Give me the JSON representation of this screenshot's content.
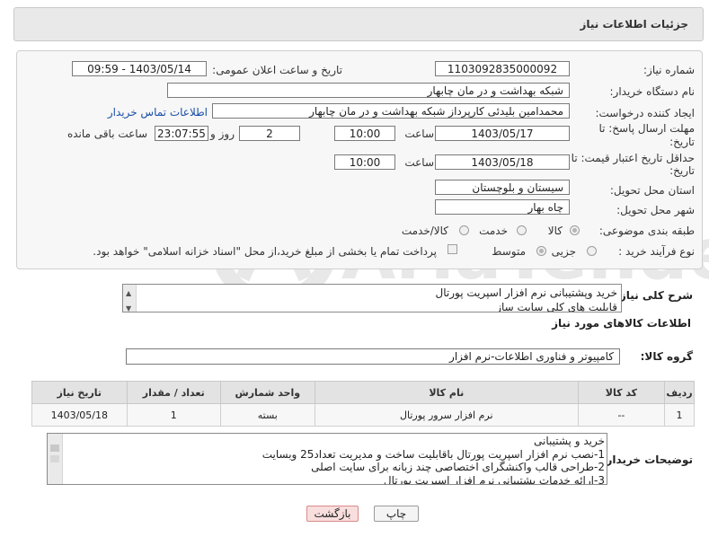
{
  "header": {
    "title": "جزئیات اطلاعات نیاز"
  },
  "form": {
    "need_number_label": "شماره نیاز:",
    "need_number": "1103092835000092",
    "announce_label": "تاریخ و ساعت اعلان عمومی:",
    "announce_value": "1403/05/14 - 09:59",
    "buyer_org_label": "نام دستگاه خریدار:",
    "buyer_org": "شبکه بهداشت و در مان چابهار",
    "requester_label": "ایجاد کننده درخواست:",
    "requester": "محمدامین بلیدئی کارپرداز شبکه بهداشت و در مان چابهار",
    "contact_link": "اطلاعات تماس خریدار",
    "deadline_label_1": "مهلت ارسال پاسخ: تا",
    "deadline_label_2": "تاریخ:",
    "deadline_date": "1403/05/17",
    "time_label": "ساعت",
    "deadline_time": "10:00",
    "days_value": "2",
    "days_label": "روز و",
    "remaining_time": "23:07:55",
    "remaining_label": "ساعت باقی مانده",
    "validity_label_1": "حداقل تاریخ اعتبار قیمت: تا",
    "validity_label_2": "تاریخ:",
    "validity_date": "1403/05/18",
    "validity_time": "10:00",
    "province_label": "استان محل تحویل:",
    "province": "سیستان و بلوچستان",
    "city_label": "شهر محل تحویل:",
    "city": "چاه بهار",
    "category_label": "طبقه بندی موضوعی:",
    "category_options": [
      "کالا",
      "خدمت",
      "کالا/خدمت"
    ],
    "purchase_type_label": "نوع فرآیند خرید :",
    "purchase_options": [
      "جزیی",
      "متوسط"
    ],
    "payment_note": "پرداخت تمام یا بخشی از مبلغ خرید،از محل \"اسناد خزانه اسلامی\" خواهد بود."
  },
  "summary": {
    "label": "شرح کلی نیاز:",
    "lines": [
      "خرید وپشتیبانی نرم افزار  اسپریت پورتال",
      "قابلیت های کلی سایت ساز"
    ]
  },
  "goods_info": {
    "title": "اطلاعات کالاهای مورد نیاز",
    "group_label": "گروه کالا:",
    "group_value": "کامپیوتر و فناوری اطلاعات-نرم افزار"
  },
  "table": {
    "headers": [
      "ردیف",
      "کد کالا",
      "نام کالا",
      "واحد شمارش",
      "تعداد / مقدار",
      "تاریخ نیاز"
    ],
    "rows": [
      [
        "1",
        "--",
        "نرم افزار سرور پورتال",
        "بسته",
        "1",
        "1403/05/18"
      ]
    ]
  },
  "buyer_notes": {
    "label": "توضیحات خریدار:",
    "lines": [
      "خرید و پشتیبانی",
      "1-نصب نرم افزار اسپریت پورتال باقابلیت ساخت و مدیریت تعداد25 وبسایت",
      "2-طراحی قالب واکنشگرای اختصاصی چند زبانه برای سایت اصلی",
      "3-ارائه خدمات پشتیبانی نرم افزار اسپریت پورتال"
    ]
  },
  "buttons": {
    "print": "چاپ",
    "back": "بازگشت"
  },
  "watermark": {
    "text": "AriaTender.neT"
  },
  "colors": {
    "link": "#1a4fa8",
    "back_button_bg": "#f9dede",
    "back_button_border": "#d77"
  }
}
